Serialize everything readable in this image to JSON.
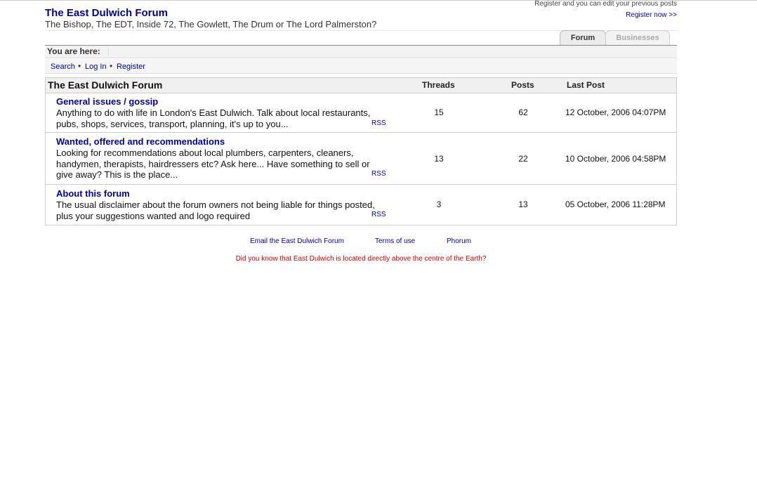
{
  "header": {
    "title": "The East Dulwich Forum",
    "subtitle": "The Bishop, The EDT, Inside 72, The Gowlett, The Drum or The Lord Palmerston?",
    "register_note": "Register and you can edit your previous posts",
    "register_link": "Register now >>"
  },
  "tabs": [
    {
      "label": "Forum",
      "active": true
    },
    {
      "label": "Businesses",
      "active": false
    }
  ],
  "breadcrumb": {
    "label": "You are here:"
  },
  "nav": {
    "search": "Search",
    "login": "Log In",
    "register": "Register",
    "separator": "•"
  },
  "table": {
    "title": "The East Dulwich Forum",
    "col_threads": "Threads",
    "col_posts": "Posts",
    "col_last": "Last Post",
    "rows": [
      {
        "name": "General issues / gossip",
        "description": "Anything to do with life in London's East Dulwich. Talk about local restaurants, pubs, shops, services, transport, planning, it's up to you...",
        "rss": "RSS",
        "threads": "15",
        "posts": "62",
        "last_post": "12 October, 2006 04:07PM"
      },
      {
        "name": "Wanted, offered and recommendations",
        "description": "Looking for recommendations about local plumbers, carpenters, cleaners, handymen, therapists, hairdressers etc? Ask here... Have something to sell or give away? This is the place...",
        "rss": "RSS",
        "threads": "13",
        "posts": "22",
        "last_post": "10 October, 2006 04:58PM"
      },
      {
        "name": "About this forum",
        "description": "The usual disclaimer about the forum owners not being liable for things posted, plus your suggestions wanted and logo required",
        "rss": "RSS",
        "threads": "3",
        "posts": "13",
        "last_post": "05 October, 2006 11:28PM"
      }
    ]
  },
  "footer": {
    "email": "Email the East Dulwich Forum",
    "terms": "Terms of use",
    "phorum": "Phorum",
    "trivia": "Did you know that East Dulwich is located directly above the centre of the Earth?"
  },
  "colors": {
    "link": "#000099",
    "trivia": "#cc0000",
    "border": "#cccccc"
  }
}
